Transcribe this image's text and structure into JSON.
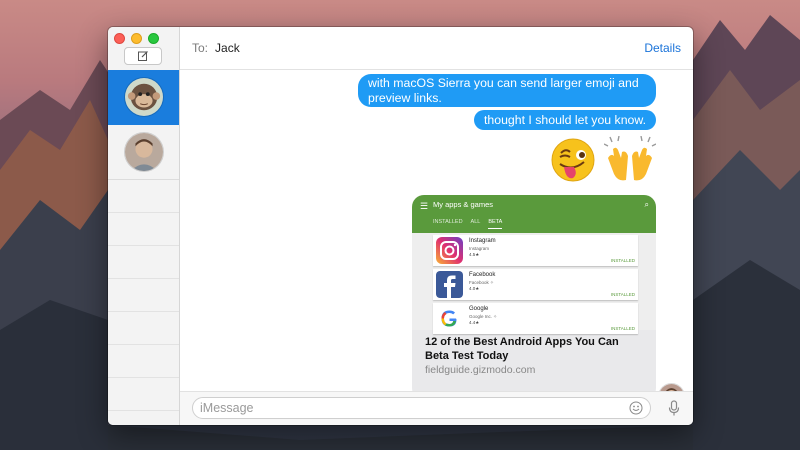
{
  "header": {
    "to_label": "To:",
    "recipient": "Jack",
    "details_label": "Details"
  },
  "conversations": [
    {
      "icon": "monkey-avatar",
      "selected": true
    },
    {
      "icon": "person-avatar",
      "selected": false
    }
  ],
  "messages": [
    {
      "text": "with macOS Sierra you can send larger emoji and preview links."
    },
    {
      "text": "thought I should let you know."
    }
  ],
  "emoji": [
    "winking-tongue-face",
    "raised-hands"
  ],
  "link_preview": {
    "screen_title": "My apps & games",
    "tabs": [
      "INSTALLED",
      "ALL",
      "BETA"
    ],
    "apps": [
      {
        "name": "Instagram",
        "developer": "Instagram",
        "rating": "4.5★",
        "status": "INSTALLED"
      },
      {
        "name": "Facebook",
        "developer": "Facebook ✧",
        "rating": "4.0★",
        "status": "INSTALLED"
      },
      {
        "name": "Google",
        "developer": "Google Inc. ✧",
        "rating": "4.4★",
        "status": "INSTALLED"
      }
    ],
    "title": "12 of the Best Android Apps You Can Beta Test Today",
    "domain": "fieldguide.gizmodo.com"
  },
  "composer": {
    "placeholder": "iMessage"
  },
  "colors": {
    "accent": "#1a7ddd",
    "bubble": "#1f9bf5",
    "play_green": "#5a9a3c"
  }
}
